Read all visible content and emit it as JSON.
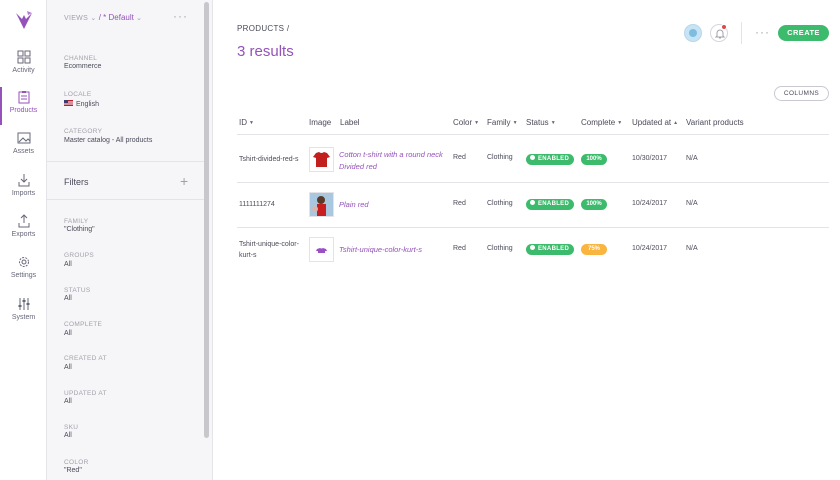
{
  "nav": {
    "items": [
      {
        "label": "Activity",
        "icon": "dashboard-icon"
      },
      {
        "label": "Products",
        "icon": "clipboard-icon",
        "active": true
      },
      {
        "label": "Assets",
        "icon": "image-icon"
      },
      {
        "label": "Imports",
        "icon": "import-icon"
      },
      {
        "label": "Exports",
        "icon": "export-icon"
      },
      {
        "label": "Settings",
        "icon": "gear-icon"
      },
      {
        "label": "System",
        "icon": "sliders-icon"
      }
    ]
  },
  "panel": {
    "views_label": "VIEWS",
    "view_selected": "/ * Default",
    "channel": {
      "label": "CHANNEL",
      "value": "Ecommerce"
    },
    "locale": {
      "label": "LOCALE",
      "value": "English"
    },
    "category": {
      "label": "CATEGORY",
      "value": "Master catalog - All products"
    },
    "filters_title": "Filters",
    "filters": [
      {
        "label": "FAMILY",
        "value": "\"Clothing\""
      },
      {
        "label": "GROUPS",
        "value": "All"
      },
      {
        "label": "STATUS",
        "value": "All"
      },
      {
        "label": "COMPLETE",
        "value": "All"
      },
      {
        "label": "CREATED AT",
        "value": "All"
      },
      {
        "label": "UPDATED AT",
        "value": "All"
      },
      {
        "label": "SKU",
        "value": "All"
      },
      {
        "label": "COLOR",
        "value": "\"Red\""
      }
    ]
  },
  "header": {
    "breadcrumb": "PRODUCTS /",
    "results": "3 results",
    "create_label": "CREATE",
    "columns_label": "COLUMNS"
  },
  "table": {
    "headers": [
      "ID",
      "Image",
      "Label",
      "Color",
      "Family",
      "Status",
      "Complete",
      "Updated at",
      "Variant products"
    ],
    "rows": [
      {
        "id": "Tshirt-divided-red-s",
        "label": "Cotton t-shirt with a round neck Divided red",
        "color": "Red",
        "family": "Clothing",
        "status": "ENABLED",
        "complete": "100%",
        "updated": "10/30/2017",
        "variants": "N/A",
        "complete_color": "#3dbb6c"
      },
      {
        "id": "1111111274",
        "label": "Plain red",
        "color": "Red",
        "family": "Clothing",
        "status": "ENABLED",
        "complete": "100%",
        "updated": "10/24/2017",
        "variants": "N/A",
        "complete_color": "#3dbb6c"
      },
      {
        "id": "Tshirt-unique-color-kurt-s",
        "label": "Tshirt-unique-color-kurt-s",
        "color": "Red",
        "family": "Clothing",
        "status": "ENABLED",
        "complete": "75%",
        "updated": "10/24/2017",
        "variants": "N/A",
        "complete_color": "#f9b53f"
      }
    ]
  },
  "colors": {
    "accent": "#9452ba",
    "success": "#3dbb6c",
    "warning": "#f9b53f"
  }
}
